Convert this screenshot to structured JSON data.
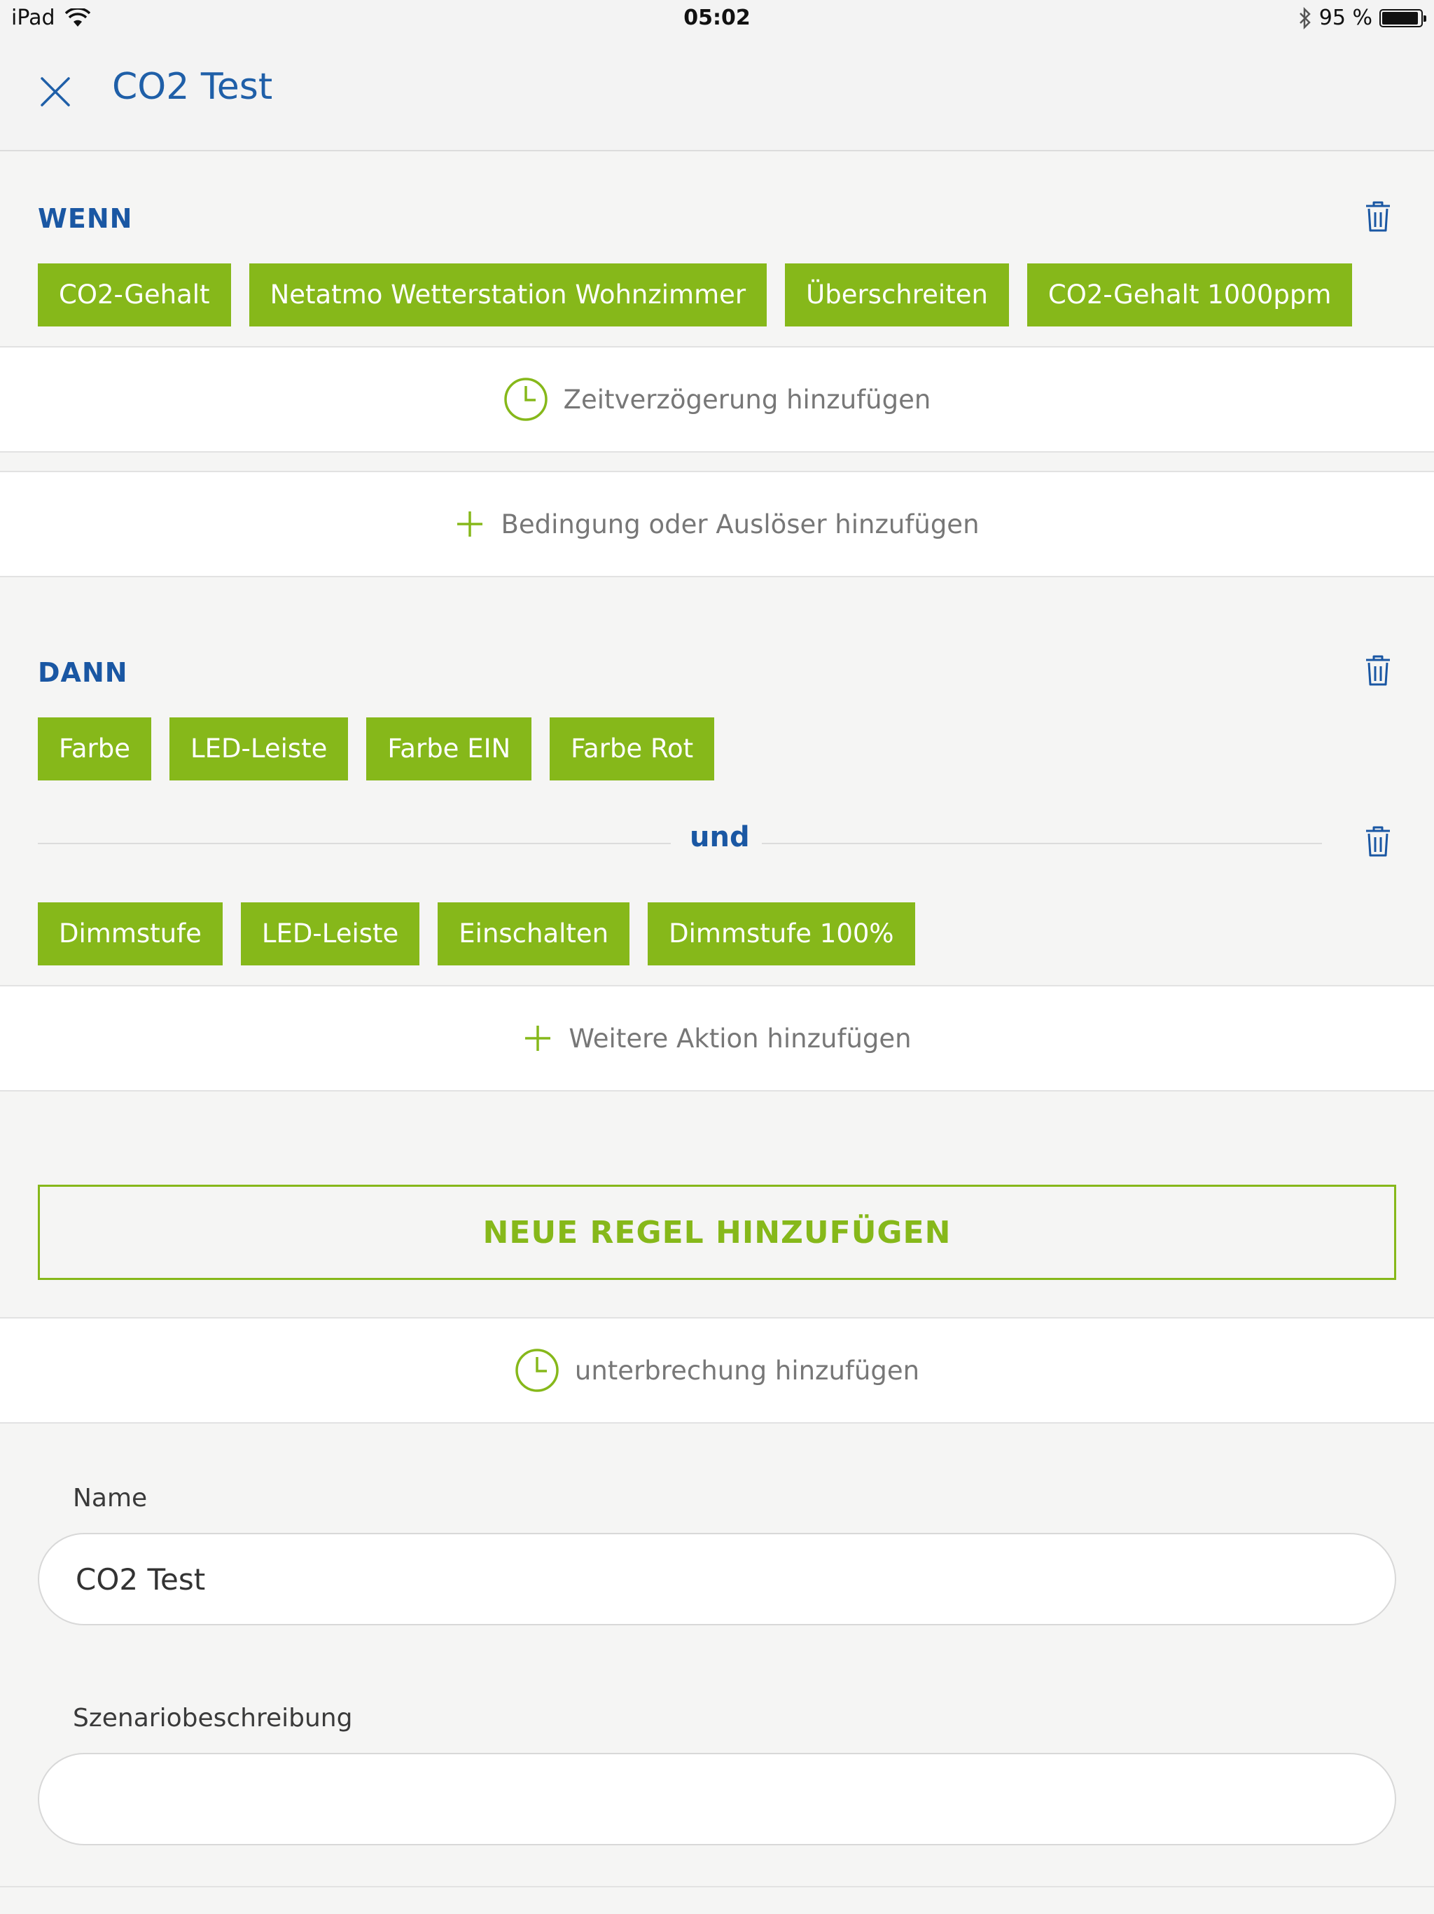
{
  "status_bar": {
    "device": "iPad",
    "time": "05:02",
    "battery": "95 %",
    "battery_level": 0.95
  },
  "header": {
    "title": "CO2 Test"
  },
  "if_block": {
    "label": "WENN",
    "chips": [
      "CO2-Gehalt",
      "Netatmo Wetterstation Wohnzimmer",
      "Überschreiten",
      "CO2-Gehalt 1000ppm"
    ],
    "delay_label": "Zeitverzögerung hinzufügen",
    "add_condition_label": "Bedingung oder Auslöser hinzufügen"
  },
  "then_block": {
    "label": "DANN",
    "actions": [
      {
        "chips": [
          "Farbe",
          "LED-Leiste",
          "Farbe EIN",
          "Farbe Rot"
        ]
      },
      {
        "chips": [
          "Dimmstufe",
          "LED-Leiste",
          "Einschalten",
          "Dimmstufe 100%"
        ]
      }
    ],
    "connector": "und",
    "add_action_label": "Weitere Aktion hinzufügen"
  },
  "new_rule_label": "NEUE REGEL HINZUFÜGEN",
  "interruption_label": "unterbrechung hinzufügen",
  "form": {
    "name_label": "Name",
    "name_value": "CO2 Test",
    "description_label": "Szenariobeschreibung",
    "description_value": ""
  },
  "colors": {
    "accent_green": "#86b81a",
    "brand_blue": "#1a57a3"
  }
}
